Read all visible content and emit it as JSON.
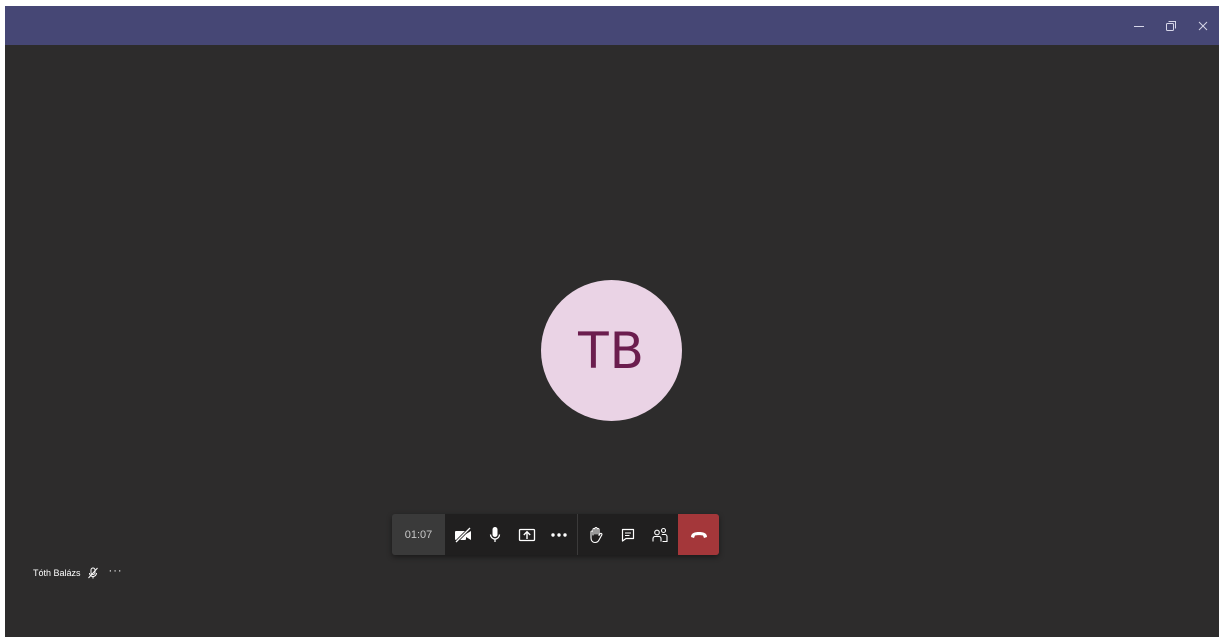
{
  "titlebar": {
    "controls": {
      "minimize_icon": "minimize-icon",
      "restore_icon": "restore-icon",
      "close_icon": "close-icon"
    },
    "color": "#464775"
  },
  "stage": {
    "background": "#2d2c2c",
    "avatar": {
      "initials": "TB",
      "background": "#ead3e5",
      "text_color": "#6b1d4e"
    }
  },
  "call_controls": {
    "timer": "01:07",
    "buttons": [
      {
        "name": "camera-off-icon"
      },
      {
        "name": "microphone-icon"
      },
      {
        "name": "share-screen-icon"
      },
      {
        "name": "more-actions-icon"
      },
      {
        "name": "raise-hand-icon"
      },
      {
        "name": "chat-icon"
      },
      {
        "name": "participants-icon"
      },
      {
        "name": "hang-up-icon"
      }
    ],
    "hangup_color": "#a4373a"
  },
  "participant": {
    "name": "Tóth Balázs",
    "mic_status_icon": "mic-muted-icon",
    "more_label": "···"
  }
}
